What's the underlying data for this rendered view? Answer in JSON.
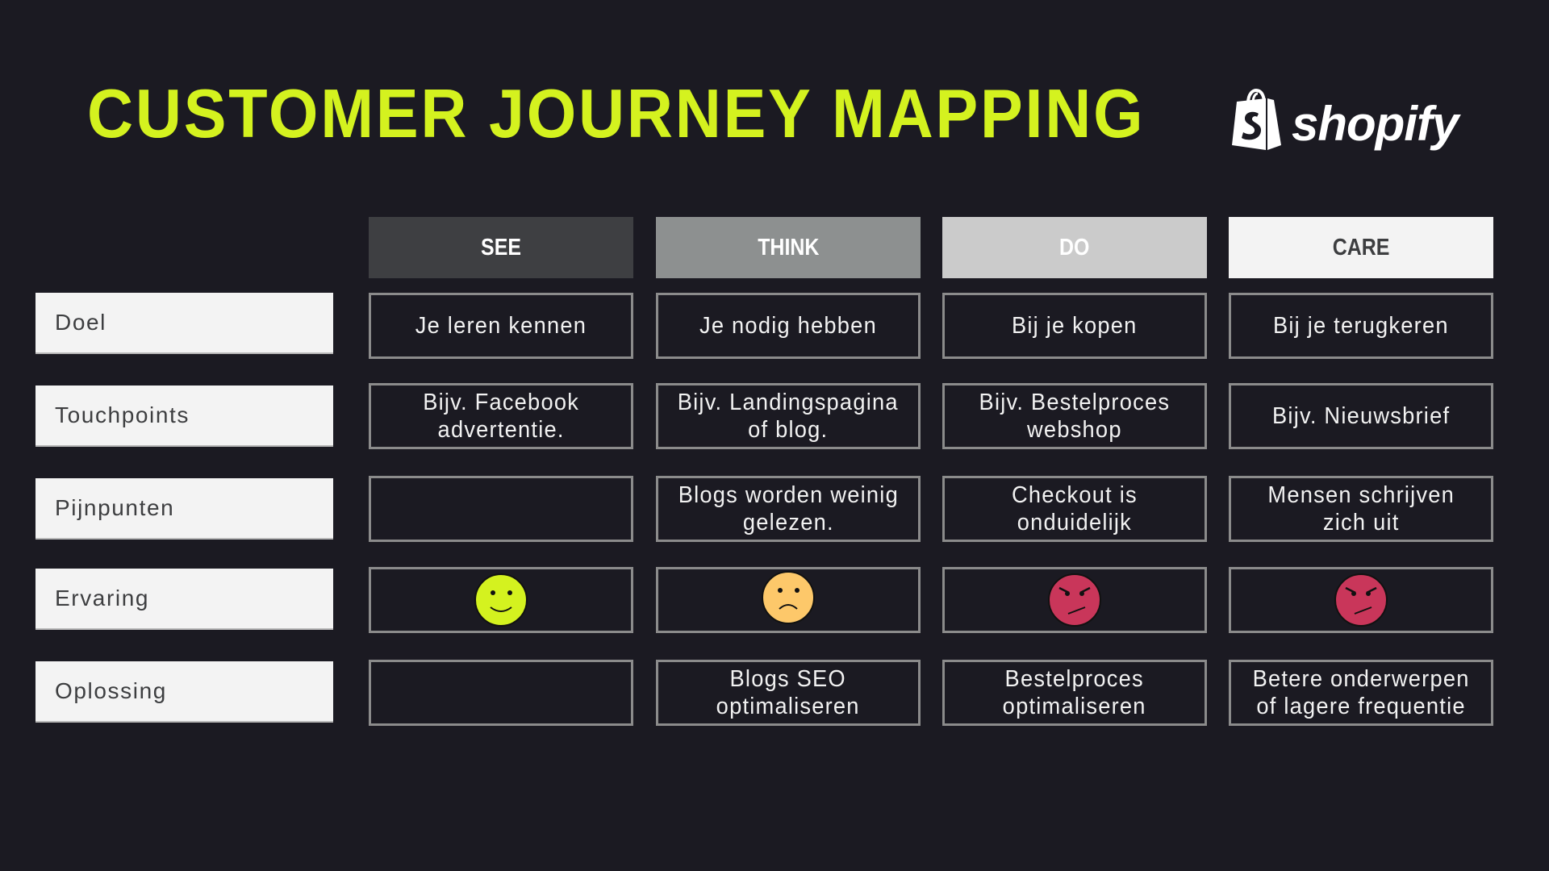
{
  "header": {
    "title": "CUSTOMER JOURNEY MAPPING",
    "logo": {
      "icon": "shopify-bag-icon",
      "wordmark": "shopify"
    }
  },
  "colors": {
    "background": "#1b1a22",
    "title_accent": "#d4f21f",
    "cell_border": "#8b8b8b",
    "label_bg": "#f3f3f3",
    "label_text": "#3d3e40"
  },
  "stages": [
    {
      "label": "SEE",
      "bg": "#3e3f42",
      "text_color": "#ffffff"
    },
    {
      "label": "THINK",
      "bg": "#8d9090",
      "text_color": "#ffffff"
    },
    {
      "label": "DO",
      "bg": "#cbcbcb",
      "text_color": "#ffffff"
    },
    {
      "label": "CARE",
      "bg": "#f3f3f3",
      "text_color": "#3d3e40"
    }
  ],
  "rows": [
    {
      "label": "Doel",
      "cells": [
        "Je leren kennen",
        "Je nodig hebben",
        "Bij je kopen",
        "Bij je terugkeren"
      ]
    },
    {
      "label": "Touchpoints",
      "cells": [
        "Bijv. Facebook\nadvertentie.",
        "Bijv. Landingspagina\nof blog.",
        "Bijv. Bestelproces\nwebshop",
        "Bijv. Nieuwsbrief"
      ]
    },
    {
      "label": "Pijnpunten",
      "cells": [
        "",
        "Blogs worden weinig\ngelezen.",
        "Checkout is\nonduidelijk",
        "Mensen schrijven\nzich uit"
      ]
    },
    {
      "label": "Ervaring",
      "faces": [
        {
          "mood": "happy",
          "icon": "happy-face-icon",
          "color": "#d4f21f"
        },
        {
          "mood": "sad",
          "icon": "sad-face-icon",
          "color": "#fdc86a"
        },
        {
          "mood": "angry",
          "icon": "angry-face-icon",
          "color": "#c9365a"
        },
        {
          "mood": "angry",
          "icon": "angry-face-icon",
          "color": "#c9365a"
        }
      ]
    },
    {
      "label": "Oplossing",
      "cells": [
        "",
        "Blogs SEO\noptimaliseren",
        "Bestelproces\noptimaliseren",
        "Betere onderwerpen\nof lagere frequentie"
      ]
    }
  ]
}
